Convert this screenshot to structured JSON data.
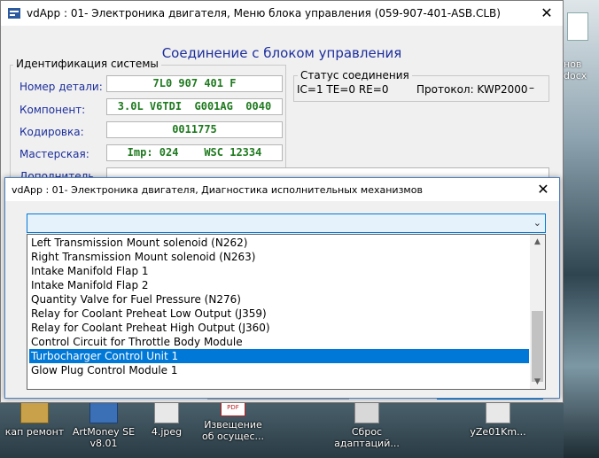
{
  "desktop": {
    "right_labels": [
      "нов",
      "docx"
    ],
    "icons": [
      {
        "label": "кап ремонт"
      },
      {
        "label": "ArtMoney SE v8.01"
      },
      {
        "label": "4.jpeg"
      },
      {
        "label": "Извещение об осущес...",
        "badge": "PDF"
      },
      {
        "label": "Сброс адаптаций..."
      },
      {
        "label": "yZe01Km..."
      }
    ]
  },
  "main_window": {
    "title": "vdApp : 01- Электроника двигателя,  Меню блока управления (059-907-401-ASB.CLB)",
    "close": "✕",
    "heading": "Соединение с блоком управления",
    "identification": {
      "caption": "Идентификация системы",
      "fields": [
        {
          "label": "Номер детали:",
          "value": "7L0 907 401 F"
        },
        {
          "label": "Компонент:",
          "value": "3.0L V6TDI  G001AG  0040"
        },
        {
          "label": "Кодировка:",
          "value": "0011775"
        },
        {
          "label": "Мастерская:",
          "value": "Imp: 024    WSC 12334"
        }
      ],
      "extra_label": "Дополнитель..."
    },
    "status": {
      "caption": "Статус соединения",
      "counters": "IC=1  TE=0   RE=0",
      "protocol": "Протокол: KWP2000",
      "protocol_suffix": "–"
    }
  },
  "dialog": {
    "title": "vdApp : 01- Электроника двигателя,  Диагностика исполнительных механизмов",
    "close": "✕",
    "combo_value": "",
    "combo_arrow": "⌄",
    "items": [
      "Left Transmission Mount solenoid (N262)",
      "Right Transmission Mount solenoid (N263)",
      "Intake Manifold Flap 1",
      "Intake Manifold Flap 2",
      "Quantity Valve for Fuel Pressure (N276)",
      "Relay for Coolant Preheat Low Output (J359)",
      "Relay for Coolant Preheat High Output (J360)",
      "Control Circuit for Throttle Body Module",
      "Turbocharger Control Unit 1",
      "Glow Plug Control Module 1"
    ],
    "selected_index": 8,
    "scroll_up": "▲",
    "scroll_down": "▼"
  },
  "colors": {
    "heading_blue": "#1c2e9c",
    "value_green": "#1f7a1f",
    "selection": "#0078d7"
  }
}
